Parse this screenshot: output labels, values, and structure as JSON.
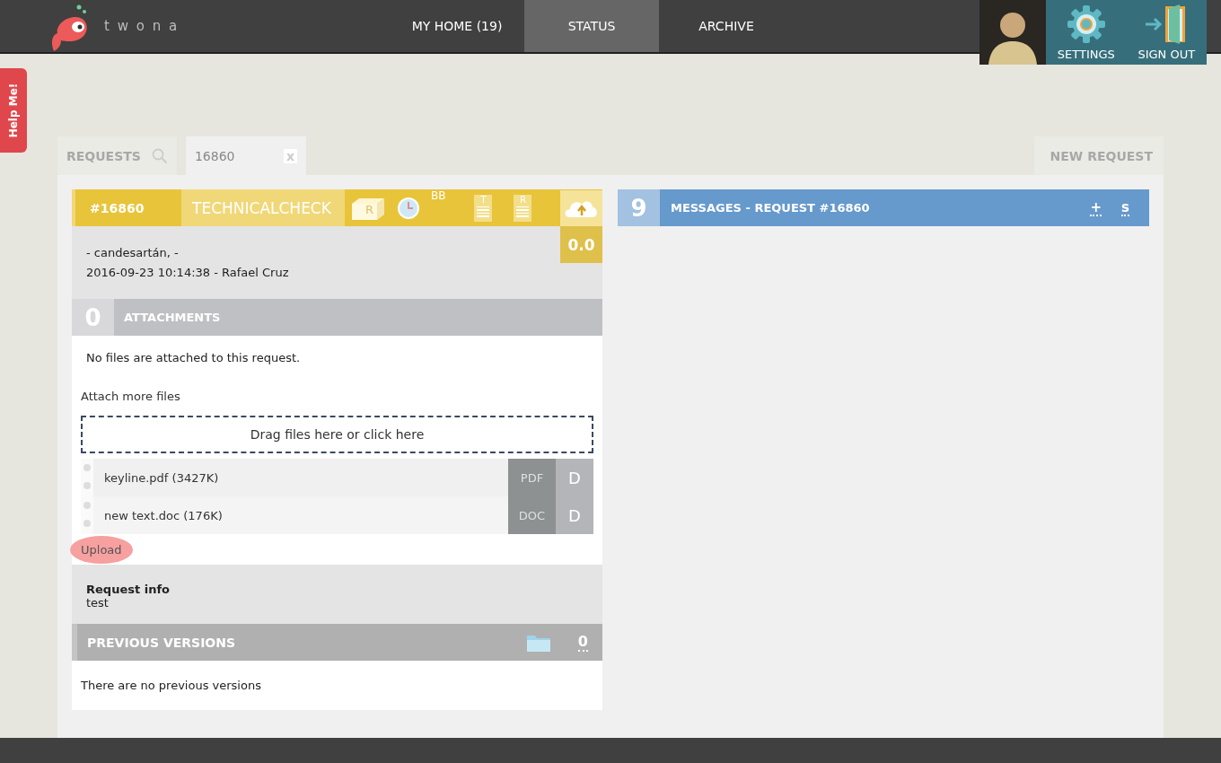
{
  "app": {
    "logo": "t w o n a"
  },
  "nav": [
    {
      "label": "MY HOME (19)",
      "selected": false
    },
    {
      "label": "STATUS",
      "selected": true
    },
    {
      "label": "ARCHIVE",
      "selected": false
    }
  ],
  "user_menu": [
    {
      "label": "SETTINGS",
      "kind": "settings"
    },
    {
      "label": "SIGN OUT",
      "kind": "signout"
    }
  ],
  "help_tab": "Help Me!",
  "tabs": [
    {
      "label": "REQUESTS",
      "kind": "search",
      "selected": false
    },
    {
      "label": "16860",
      "kind": "close",
      "close": "x",
      "selected": true
    }
  ],
  "new_request": "NEW REQUEST",
  "request": {
    "id": "#16860",
    "status": "TECHNICALCHECK",
    "box_letter": "R",
    "bb": "BB",
    "doc_letters": [
      "T",
      "R"
    ],
    "score": "0.0",
    "lines": [
      "- candesartán, -",
      "2016-09-23 10:14:38 - Rafael Cruz"
    ]
  },
  "attachments": {
    "count": "0",
    "title": "ATTACHMENTS",
    "empty_text": "No files are attached to this request.",
    "attach_label": "Attach more files",
    "dropzone": "Drag files here or click here",
    "files": [
      {
        "name": "keyline.pdf (3427K)",
        "type": "PDF",
        "action": "D"
      },
      {
        "name": "new text.doc (176K)",
        "type": "DOC",
        "action": "D"
      }
    ],
    "upload": "Upload"
  },
  "request_info": {
    "title": "Request info",
    "text": "test"
  },
  "previous_versions": {
    "title": "PREVIOUS VERSIONS",
    "count": "0",
    "empty_text": "There are no previous versions"
  },
  "messages": {
    "count": "9",
    "title": "MESSAGES - REQUEST #16860",
    "actions": [
      "+",
      "s"
    ]
  }
}
